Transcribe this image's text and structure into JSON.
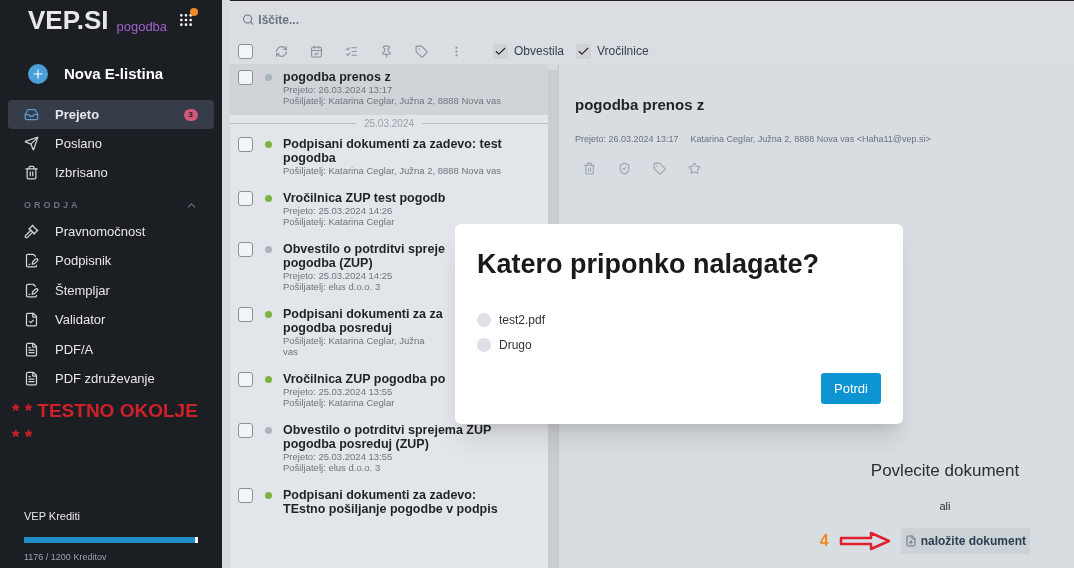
{
  "sidebar": {
    "brand": "VEP.SI",
    "product": "pogodba",
    "apps_notification": true,
    "new_button": "Nova E-listina",
    "nav": [
      {
        "label": "Prejeto",
        "selected": true,
        "badge": "3"
      },
      {
        "label": "Poslano",
        "selected": false
      },
      {
        "label": "Izbrisano",
        "selected": false
      }
    ],
    "section": {
      "title": "ORODJA",
      "expanded": true
    },
    "tools": [
      {
        "label": "Pravnomočnost"
      },
      {
        "label": "Podpisnik"
      },
      {
        "label": "Štempljar"
      },
      {
        "label": "Validator"
      },
      {
        "label": "PDF/A"
      },
      {
        "label": "PDF združevanje"
      }
    ],
    "warning": "* * TESTNO OKOLJE * *",
    "credits": {
      "label": "VEP Krediti",
      "level": 0.98,
      "text": "1176 / 1200 Kreditov"
    }
  },
  "search": {
    "placeholder": "Iščite..."
  },
  "toolbar": {
    "select_all": false,
    "filters": [
      {
        "label": "Obvestila",
        "checked": true
      },
      {
        "label": "Vročilnice",
        "checked": true
      }
    ]
  },
  "messages": [
    {
      "kind": "message",
      "title": "pogodba prenos z",
      "lines": [
        "Prejeto: 26.03.2024 13:17",
        "Pošiljatelj: Katarina Ceglar, Južna 2, 8888 Nova vas"
      ],
      "color": "#aab4bd",
      "checked": false,
      "selected": true
    },
    {
      "kind": "separator",
      "title": "25.03.2024"
    },
    {
      "kind": "message",
      "title": "Podpisani dokumenti za zadevo: test pogodba",
      "lines": [
        "Pošiljatelj: Katarina Ceglar, Južna 2, 8888 Nova vas"
      ],
      "color": "#7cb342",
      "checked": false,
      "selected": false
    },
    {
      "kind": "message",
      "title": "Vročilnica ZUP test pogodb",
      "lines": [
        "Prejeto: 25.03.2024 14:26",
        "Pošiljatelj: Katarina Ceglar"
      ],
      "color": "#7cb342",
      "checked": false,
      "selected": false
    },
    {
      "kind": "message",
      "title": "Obvestilo o potrditvi spreje",
      "title2": "pogodba (ZUP)",
      "lines": [
        "Prejeto: 25.03.2024 14:25",
        "Pošiljatelj: elus d.o.o. 3"
      ],
      "color": "#aab4bd",
      "checked": false,
      "selected": false
    },
    {
      "kind": "message",
      "title": "Podpisani dokumenti za za",
      "title2": "pogodba posreduj",
      "lines": [
        "Pošiljatelj: Katarina Ceglar, Južna",
        "vas"
      ],
      "color": "#7cb342",
      "checked": false,
      "selected": false
    },
    {
      "kind": "message",
      "title": "Vročilnica ZUP pogodba po",
      "lines": [
        "Prejeto: 25.03.2024 13:55",
        "Pošiljatelj: Katarina Ceglar"
      ],
      "color": "#7cb342",
      "checked": false,
      "selected": false
    },
    {
      "kind": "message",
      "title": "Obvestilo o potrditvi sprejema ZUP pogodba posreduj (ZUP)",
      "lines": [
        "Prejeto: 25.03.2024 13:55",
        "Pošiljatelj: elus d.o.o. 3"
      ],
      "color": "#aab4bd",
      "checked": false,
      "selected": false
    },
    {
      "kind": "message",
      "title": "Podpisani dokumenti za zadevo: TEstno pošiljanje pogodbe v podpis",
      "color": "#7cb342",
      "checked": false,
      "selected": false
    }
  ],
  "detail": {
    "title": "pogodba prenos z",
    "received": "Prejeto: 26.03.2024 13:17",
    "sender": "Katarina Ceglar, Južna 2, 8888 Nova vas <Haha11@vep.si>"
  },
  "dialog": {
    "title": "Katero priponko nalagate?",
    "options": [
      {
        "label": "test2.pdf",
        "selected": false
      },
      {
        "label": "Drugo",
        "selected": false
      }
    ],
    "button": "Potrdi"
  },
  "upload": {
    "heading": "Povlecite dokument",
    "or": "ali",
    "step": "4",
    "button": "naložite dokument"
  }
}
